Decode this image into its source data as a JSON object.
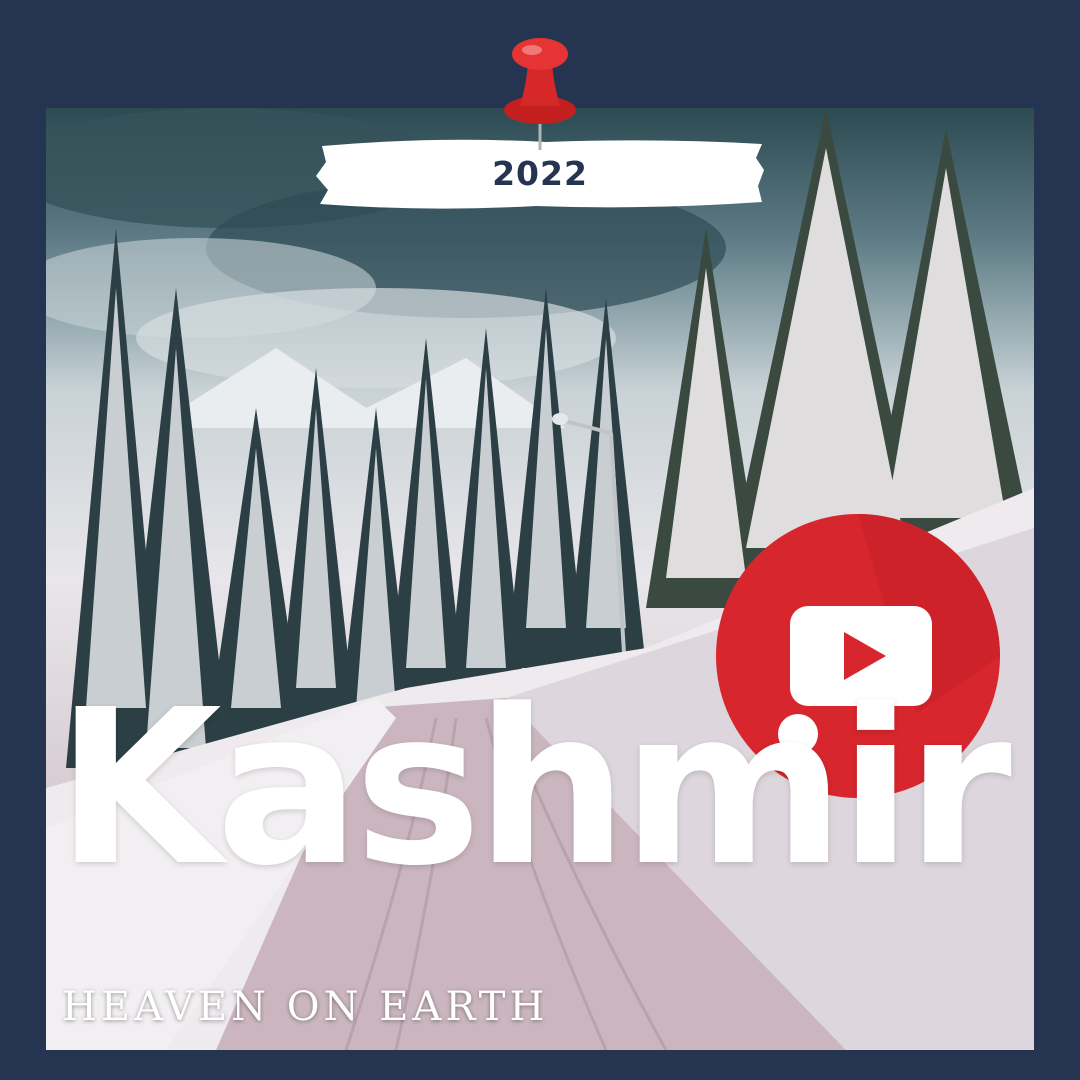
{
  "card": {
    "year": "2022",
    "title": "Kashmir",
    "subtitle": "HEAVEN ON EARTH"
  },
  "icons": {
    "pin": "push-pin-icon",
    "play": "youtube-play-icon"
  },
  "colors": {
    "background": "#253450",
    "pin": "#d62828",
    "play_badge": "#d7262d",
    "text": "#ffffff"
  }
}
